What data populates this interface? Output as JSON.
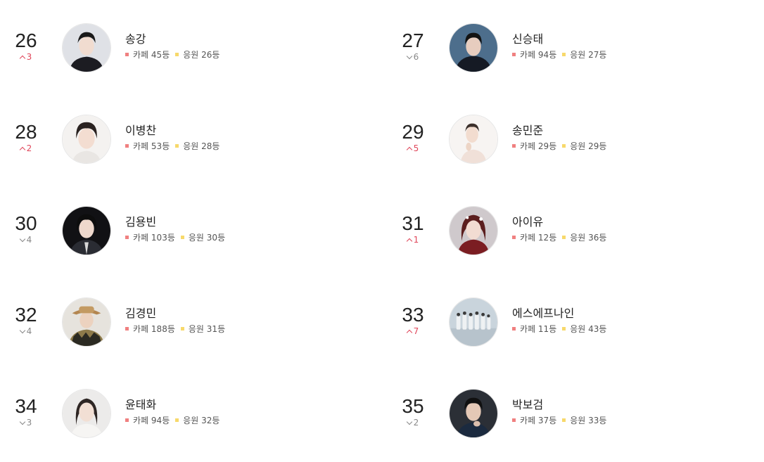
{
  "colors": {
    "up": "#e0465a",
    "down": "#888888",
    "cafe_marker": "#f08080",
    "support_marker": "#f7d96b"
  },
  "labels": {
    "cafe": "카페",
    "support": "응원",
    "rank_suffix": "등"
  },
  "entries": [
    {
      "rank": "26",
      "direction": "up",
      "change": "3",
      "name": "송강",
      "cafe": "45등",
      "support": "26등"
    },
    {
      "rank": "27",
      "direction": "down",
      "change": "6",
      "name": "신승태",
      "cafe": "94등",
      "support": "27등"
    },
    {
      "rank": "28",
      "direction": "up",
      "change": "2",
      "name": "이병찬",
      "cafe": "53등",
      "support": "28등"
    },
    {
      "rank": "29",
      "direction": "up",
      "change": "5",
      "name": "송민준",
      "cafe": "29등",
      "support": "29등"
    },
    {
      "rank": "30",
      "direction": "down",
      "change": "4",
      "name": "김용빈",
      "cafe": "103등",
      "support": "30등"
    },
    {
      "rank": "31",
      "direction": "up",
      "change": "1",
      "name": "아이유",
      "cafe": "12등",
      "support": "36등"
    },
    {
      "rank": "32",
      "direction": "down",
      "change": "4",
      "name": "김경민",
      "cafe": "188등",
      "support": "31등"
    },
    {
      "rank": "33",
      "direction": "up",
      "change": "7",
      "name": "에스에프나인",
      "cafe": "11등",
      "support": "43등"
    },
    {
      "rank": "34",
      "direction": "down",
      "change": "3",
      "name": "윤태화",
      "cafe": "94등",
      "support": "32등"
    },
    {
      "rank": "35",
      "direction": "down",
      "change": "2",
      "name": "박보검",
      "cafe": "37등",
      "support": "33등"
    }
  ]
}
